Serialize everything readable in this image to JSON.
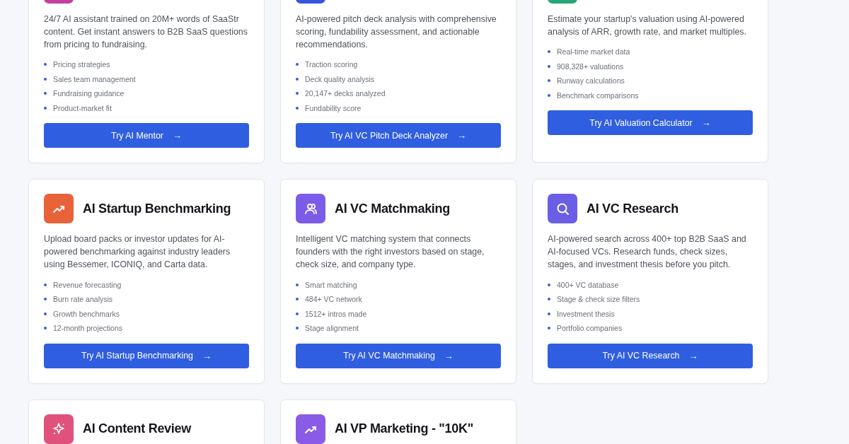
{
  "cards": [
    {
      "icon": {
        "kind": "none",
        "color": "#c2409f"
      },
      "description": "24/7 AI assistant trained on 20M+ words of SaaStr content. Get instant answers to B2B SaaS questions from pricing to fundraising.",
      "features": [
        "Pricing strategies",
        "Sales team management",
        "Fundraising guidance",
        "Product-market fit"
      ],
      "button": "Try AI Mentor",
      "button_icon": "→"
    },
    {
      "icon": {
        "kind": "none",
        "color": "#3557e0"
      },
      "description": "AI-powered pitch deck analysis with comprehensive scoring, fundability assessment, and actionable recommendations.",
      "features": [
        "Traction scoring",
        "Deck quality analysis",
        "20,147+ decks analyzed",
        "Fundability score"
      ],
      "button": "Try AI VC Pitch Deck Analyzer",
      "button_icon": "→"
    },
    {
      "icon": {
        "kind": "none",
        "color": "#27a776"
      },
      "description": "Estimate your startup's valuation using AI-powered analysis of ARR, growth rate, and market multiples.",
      "features": [
        "Real-time market data",
        "908,328+ valuations",
        "Runway calculations",
        "Benchmark comparisons"
      ],
      "button": "Try AI Valuation Calculator",
      "button_icon": "→"
    },
    {
      "icon": {
        "kind": "trend",
        "color": "#e8623a"
      },
      "title": "AI Startup Benchmarking",
      "description": "Upload board packs or investor updates for AI-powered benchmarking against industry leaders using Bessemer, ICONIQ, and Carta data.",
      "features": [
        "Revenue forecasting",
        "Burn rate analysis",
        "Growth benchmarks",
        "12-month projections"
      ],
      "button": "Try AI Startup Benchmarking",
      "button_icon": "→"
    },
    {
      "icon": {
        "kind": "users",
        "color": "#7b5ce8"
      },
      "title": "AI VC Matchmaking",
      "description": "Intelligent VC matching system that connects founders with the right investors based on stage, check size, and company type.",
      "features": [
        "Smart matching",
        "484+ VC network",
        "1512+ intros made",
        "Stage alignment"
      ],
      "button": "Try AI VC Matchmaking",
      "button_icon": "→"
    },
    {
      "icon": {
        "kind": "search",
        "color": "#6a5ee6"
      },
      "title": "AI VC Research",
      "description": "AI-powered search across 400+ top B2B SaaS and AI-focused VCs. Research funds, check sizes, stages, and investment thesis before you pitch.",
      "features": [
        "400+ VC database",
        "Stage & check size filters",
        "Investment thesis",
        "Portfolio companies"
      ],
      "button": "Try AI VC Research",
      "button_icon": "→"
    },
    {
      "icon": {
        "kind": "sparkle",
        "color": "#e0527c"
      },
      "title": "AI Content Review"
    },
    {
      "icon": {
        "kind": "trend",
        "color": "#8a5be6"
      },
      "title": "AI VP Marketing - \"10K\""
    }
  ]
}
